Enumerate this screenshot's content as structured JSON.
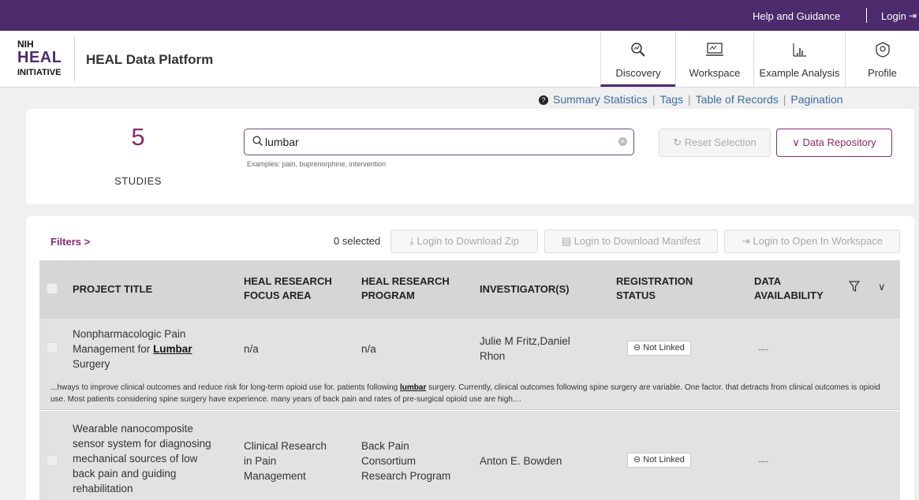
{
  "topbar": {
    "help": "Help and Guidance",
    "login": "Login",
    "login_icon": "login-icon",
    "bg_color": "#4c2a6b"
  },
  "header": {
    "logo": {
      "nih": "NIH",
      "heal": "HEAL",
      "initiative": "INITIATIVE"
    },
    "brand": "HEAL Data Platform",
    "nav": [
      {
        "label": "Discovery",
        "icon": "discovery-icon",
        "active": true
      },
      {
        "label": "Workspace",
        "icon": "workspace-icon",
        "active": false
      },
      {
        "label": "Example Analysis",
        "icon": "chart-icon",
        "active": false
      },
      {
        "label": "Profile",
        "icon": "profile-icon",
        "active": false
      }
    ]
  },
  "links": {
    "summary": "Summary Statistics",
    "tags": "Tags",
    "table": "Table of Records",
    "pagination": "Pagination"
  },
  "search": {
    "count": "5",
    "count_label": "STUDIES",
    "query": "lumbar",
    "examples": "Examples: pain, buprenorphine, intervention",
    "reset": "Reset Selection",
    "repository": "Data Repository"
  },
  "results": {
    "filters": "Filters",
    "selected": "0 selected",
    "actions": {
      "download_zip": "Login to Download Zip",
      "download_manifest": "Login to Download Manifest",
      "open_workspace": "Login to Open In Workspace"
    },
    "columns": {
      "title": "PROJECT TITLE",
      "focus_1": "HEAL RESEARCH",
      "focus_2": "FOCUS AREA",
      "program_1": "HEAL RESEARCH",
      "program_2": "PROGRAM",
      "investigators": "INVESTIGATOR(S)",
      "registration_1": "REGISTRATION",
      "registration_2": "STATUS",
      "availability_1": "DATA",
      "availability_2": "AVAILABILITY"
    },
    "rows": [
      {
        "title_a": "Nonpharmacologic Pain",
        "title_b": "Management for ",
        "title_hl": "Lumbar",
        "title_c": "Surgery",
        "focus": "n/a",
        "program": "n/a",
        "investigators_1": "Julie M Fritz,Daniel",
        "investigators_2": "Rhon",
        "status": "Not Linked",
        "availability": "---",
        "snippet_a": "...hways to improve clinical outcomes and reduce risk for long-term opioid use for. patients following ",
        "snippet_hl": "lumbar",
        "snippet_b": " surgery. Currently, clinical outcomes following spine surgery are variable. One factor. that detracts from clinical outcomes is opioid use. Most patients considering spine surgery have experience. many years of back pain and rates of pre-surgical opioid use are high...."
      },
      {
        "title_lines": [
          "Wearable nanocomposite",
          "sensor system for diagnosing",
          "mechanical sources of low",
          "back pain and guiding",
          "rehabilitation"
        ],
        "focus_lines": [
          "Clinical Research",
          "in Pain",
          "Management"
        ],
        "program_lines": [
          "Back Pain",
          "Consortium",
          "Research Program"
        ],
        "investigators": "Anton E. Bowden",
        "status": "Not Linked",
        "availability": "---"
      }
    ]
  }
}
